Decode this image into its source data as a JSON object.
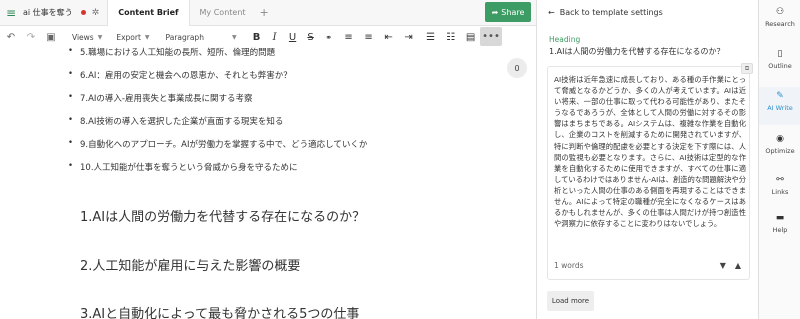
{
  "topbar": {
    "doc_title": "ai 仕事を奪う",
    "tabs": [
      "Content Brief",
      "My Content"
    ],
    "share_label": "Share"
  },
  "toolbar": {
    "views_label": "Views",
    "export_label": "Export",
    "paragraph_label": "Paragraph",
    "more_label": "•••"
  },
  "editor": {
    "list_items": [
      "5.職場における人工知能の長所、短所、倫理的問題",
      "6.AI：雇用の安定と機会への恩恵か、それとも弊害か？",
      "7.AIの導入-雇用喪失と事業成長に関する考察",
      "8.AI技術の導入を選択した企業が直面する現実を知る",
      "9.自動化へのアプローチ。AIが労働力を掌握する中で、どう適応していくか",
      "10.人工知能が仕事を奪うという脅威から身を守るために"
    ],
    "headings": [
      "1.AIは人間の労働力を代替する存在になるのか？",
      "2.人工知能が雇用に与えた影響の概要",
      "3.AIと自動化によって最も脅かされる5つの仕事"
    ],
    "badge_count": "0"
  },
  "panel": {
    "back_label": "Back to template settings",
    "heading_label": "Heading",
    "heading_title": "1.AIは人間の労働力を代替する存在になるのか？",
    "card_text": "AI技術は近年急速に成長しており、ある種の手作業にとって脅威となるかどうか、多くの人が考えています。AIは近い将来、一部の仕事に取って代わる可能性があり、またそうなるであろうが、全体として人間の労働に対するその影響はまちまちである。AIシステムは、複雑な作業を自動化し、企業のコストを削減するために開発されていますが、特に判断や倫理的配慮を必要とする決定を下す際には、人間の監視も必要となります。さらに、AI技術は定型的な作業を自動化するために使用できますが、すべての仕事に適しているわけではありません-AIは、創造的な問題解決や分析といった人間の仕事のある側面を再現することはできません。AIによって特定の職種が完全になくなるケースはあるかもしれませんが、多くの仕事は人間だけが持つ創造性や洞察力に依存することに変わりはないでしょう。",
    "word_count": "1 words",
    "load_more_label": "Load more"
  },
  "sidebar": {
    "items": [
      "Research",
      "Outline",
      "AI Write",
      "Optimize",
      "Links",
      "Help"
    ],
    "active": "AI Write"
  },
  "colors": {
    "accent_green": "#3d9b64",
    "active_blue": "#2f8fcf",
    "status_red": "#d9342b"
  }
}
